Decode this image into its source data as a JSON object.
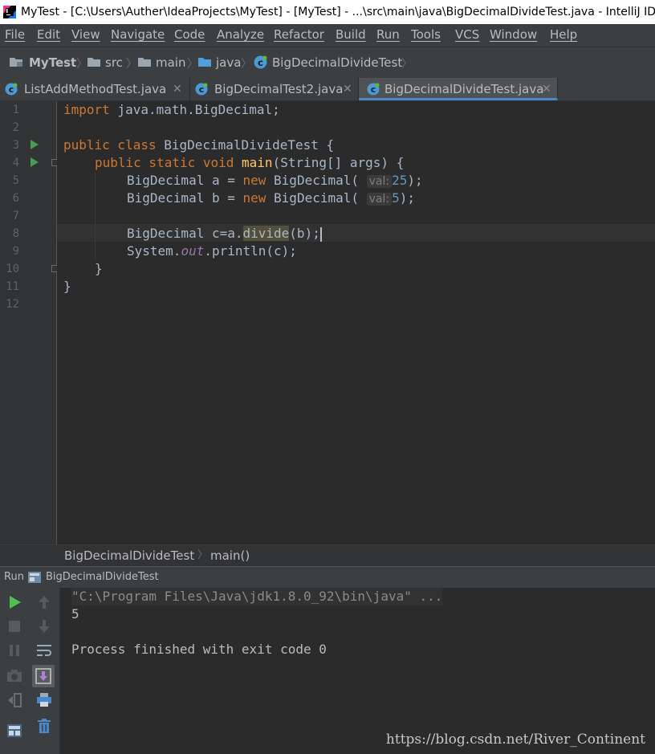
{
  "window": {
    "title": "MyTest - [C:\\Users\\Auther\\IdeaProjects\\MyTest] - [MyTest] - ...\\src\\main\\java\\BigDecimalDivideTest.java - IntelliJ IDEA"
  },
  "menu": [
    "File",
    "Edit",
    "View",
    "Navigate",
    "Code",
    "Analyze",
    "Refactor",
    "Build",
    "Run",
    "Tools",
    "VCS",
    "Window",
    "Help"
  ],
  "breadcrumb": [
    "MyTest",
    "src",
    "main",
    "java",
    "BigDecimalDivideTest"
  ],
  "tabs": [
    {
      "label": "ListAddMethodTest.java",
      "active": false
    },
    {
      "label": "BigDecimalTest2.java",
      "active": false
    },
    {
      "label": "BigDecimalDivideTest.java",
      "active": true
    }
  ],
  "editor": {
    "line_numbers": [
      "1",
      "2",
      "3",
      "4",
      "5",
      "6",
      "7",
      "8",
      "9",
      "10",
      "11",
      "12"
    ],
    "lines": {
      "l1": {
        "k1": "import",
        "t1": " java.math.BigDecimal;"
      },
      "l3": {
        "k1": "public class",
        "t1": " BigDecimalDivideTest {"
      },
      "l4": {
        "k1": "public static void",
        "f1": "main",
        "t1": "(String[] args) {"
      },
      "l5": {
        "t1": "BigDecimal a = ",
        "k1": "new",
        "t2": " BigDecimal(",
        "hint": "val:",
        "n1": "25",
        "t3": ");"
      },
      "l6": {
        "t1": "BigDecimal b = ",
        "k1": "new",
        "t2": " BigDecimal(",
        "hint": "val:",
        "n1": "5",
        "t3": ");"
      },
      "l8": {
        "t1": "BigDecimal c=a.",
        "h1": "divide",
        "t2": "(b);"
      },
      "l9": {
        "t1": "System.",
        "s1": "out",
        "t2": ".println(c);"
      },
      "l10": {
        "t1": "}"
      },
      "l11": {
        "t1": "}"
      }
    },
    "structure_crumb": [
      "BigDecimalDivideTest",
      "main()"
    ]
  },
  "run": {
    "label": "Run",
    "config": "BigDecimalDivideTest",
    "console": [
      "\"C:\\Program Files\\Java\\jdk1.8.0_92\\bin\\java\" ...",
      "5",
      "",
      "Process finished with exit code 0"
    ]
  },
  "watermark": "https://blog.csdn.net/River_Continent",
  "colors": {
    "keyword": "#cc7832",
    "function": "#ffc66d",
    "number": "#6897bb",
    "static_field": "#9876aa",
    "text": "#a9b7c6",
    "background": "#2b2b2b",
    "tab_accent": "#4a88c7",
    "run_green": "#499c54"
  }
}
